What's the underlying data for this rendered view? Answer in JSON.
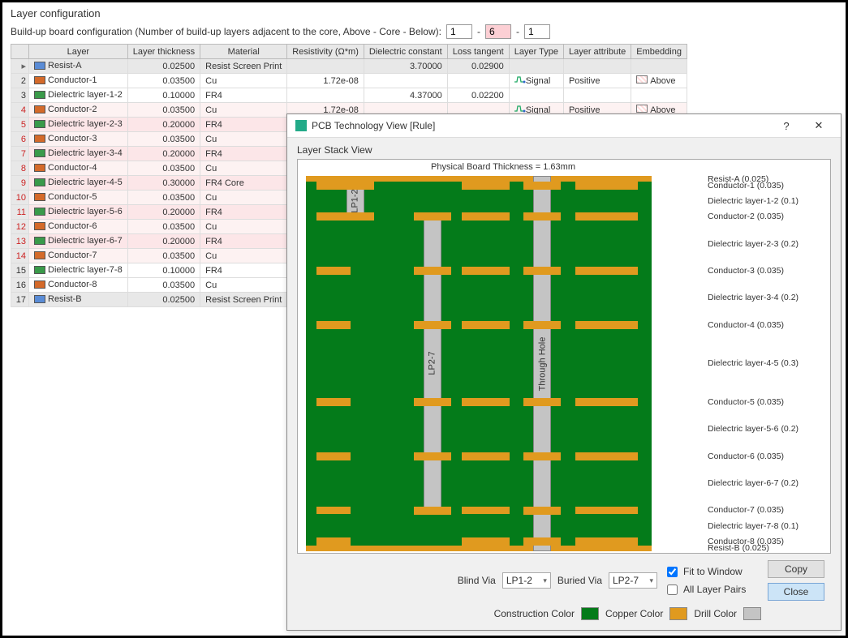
{
  "title": "Layer configuration",
  "config_line": "Build-up board configuration (Number of build-up layers adjacent to the core, Above - Core - Below):",
  "config_above": "1",
  "config_core": "6",
  "config_below": "1",
  "headers": [
    "Layer",
    "Layer thickness",
    "Material",
    "Resistivity (Ω*m)",
    "Dielectric constant",
    "Loss tangent",
    "Layer Type",
    "Layer attribute",
    "Embedding"
  ],
  "layers": [
    {
      "idx": "",
      "kind": "resist",
      "name": "Resist-A",
      "thick": "0.02500",
      "mat": "Resist Screen Print",
      "res": "",
      "dk": "3.70000",
      "lt": "0.02900"
    },
    {
      "idx": "2",
      "kind": "conductor",
      "name": "Conductor-1",
      "thick": "0.03500",
      "mat": "Cu",
      "res": "1.72e-08",
      "type": "Signal",
      "attr": "Positive",
      "emb": "Above"
    },
    {
      "idx": "3",
      "kind": "dielectric",
      "name": "Dielectric layer-1-2",
      "thick": "0.10000",
      "mat": "FR4",
      "dk": "4.37000",
      "lt": "0.02200"
    },
    {
      "idx": "4",
      "kind": "conductor",
      "name": "Conductor-2",
      "thick": "0.03500",
      "mat": "Cu",
      "res": "1.72e-08",
      "type": "Signal",
      "attr": "Positive",
      "emb": "Above",
      "core": true
    },
    {
      "idx": "5",
      "kind": "dielectric",
      "name": "Dielectric layer-2-3",
      "thick": "0.20000",
      "mat": "FR4",
      "core": true
    },
    {
      "idx": "6",
      "kind": "conductor",
      "name": "Conductor-3",
      "thick": "0.03500",
      "mat": "Cu",
      "core": true
    },
    {
      "idx": "7",
      "kind": "dielectric",
      "name": "Dielectric layer-3-4",
      "thick": "0.20000",
      "mat": "FR4",
      "core": true
    },
    {
      "idx": "8",
      "kind": "conductor",
      "name": "Conductor-4",
      "thick": "0.03500",
      "mat": "Cu",
      "core": true
    },
    {
      "idx": "9",
      "kind": "dielectric",
      "name": "Dielectric layer-4-5",
      "thick": "0.30000",
      "mat": "FR4 Core",
      "core": true
    },
    {
      "idx": "10",
      "kind": "conductor",
      "name": "Conductor-5",
      "thick": "0.03500",
      "mat": "Cu",
      "core": true
    },
    {
      "idx": "11",
      "kind": "dielectric",
      "name": "Dielectric layer-5-6",
      "thick": "0.20000",
      "mat": "FR4",
      "core": true
    },
    {
      "idx": "12",
      "kind": "conductor",
      "name": "Conductor-6",
      "thick": "0.03500",
      "mat": "Cu",
      "core": true
    },
    {
      "idx": "13",
      "kind": "dielectric",
      "name": "Dielectric layer-6-7",
      "thick": "0.20000",
      "mat": "FR4",
      "core": true
    },
    {
      "idx": "14",
      "kind": "conductor",
      "name": "Conductor-7",
      "thick": "0.03500",
      "mat": "Cu",
      "core": true
    },
    {
      "idx": "15",
      "kind": "dielectric",
      "name": "Dielectric layer-7-8",
      "thick": "0.10000",
      "mat": "FR4"
    },
    {
      "idx": "16",
      "kind": "conductor",
      "name": "Conductor-8",
      "thick": "0.03500",
      "mat": "Cu"
    },
    {
      "idx": "17",
      "kind": "resist",
      "name": "Resist-B",
      "thick": "0.02500",
      "mat": "Resist Screen Print"
    }
  ],
  "dialog": {
    "title": "PCB Technology View [Rule]",
    "section": "Layer Stack View",
    "board_thickness": "Physical Board Thickness = 1.63mm",
    "labels": [
      {
        "text": "Resist-A (0.025)",
        "weight": 0.025
      },
      {
        "text": "Conductor-1 (0.035)",
        "weight": 0.035
      },
      {
        "text": "Dielectric layer-1-2 (0.1)",
        "weight": 0.1
      },
      {
        "text": "Conductor-2 (0.035)",
        "weight": 0.035
      },
      {
        "text": "Dielectric layer-2-3 (0.2)",
        "weight": 0.2
      },
      {
        "text": "Conductor-3 (0.035)",
        "weight": 0.035
      },
      {
        "text": "Dielectric layer-3-4 (0.2)",
        "weight": 0.2
      },
      {
        "text": "Conductor-4 (0.035)",
        "weight": 0.035
      },
      {
        "text": "Dielectric layer-4-5 (0.3)",
        "weight": 0.3
      },
      {
        "text": "Conductor-5 (0.035)",
        "weight": 0.035
      },
      {
        "text": "Dielectric layer-5-6 (0.2)",
        "weight": 0.2
      },
      {
        "text": "Conductor-6 (0.035)",
        "weight": 0.035
      },
      {
        "text": "Dielectric layer-6-7 (0.2)",
        "weight": 0.2
      },
      {
        "text": "Conductor-7 (0.035)",
        "weight": 0.035
      },
      {
        "text": "Dielectric layer-7-8 (0.1)",
        "weight": 0.1
      },
      {
        "text": "Conductor-8 (0.035)",
        "weight": 0.035
      },
      {
        "text": "Resist-B (0.025)",
        "weight": 0.025
      }
    ],
    "vias": {
      "lp12": "LP1-2",
      "lp27": "LP2-7",
      "through": "Through Hole"
    },
    "controls": {
      "blind_label": "Blind Via",
      "blind_val": "LP1-2",
      "buried_label": "Buried Via",
      "buried_val": "LP2-7",
      "fit": "Fit to Window",
      "all_pairs": "All Layer Pairs",
      "copy": "Copy",
      "close": "Close",
      "construction": "Construction Color",
      "copper": "Copper Color",
      "drill": "Drill Color"
    }
  },
  "colors": {
    "construction": "#047b1a",
    "copper": "#e09a1f",
    "drill": "#c4c4c4"
  }
}
